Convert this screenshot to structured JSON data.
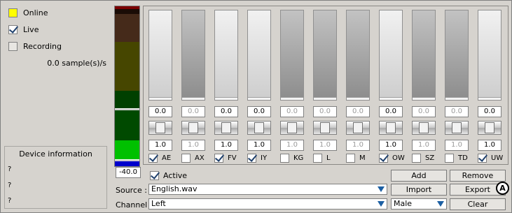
{
  "status": {
    "online_label": "Online",
    "live_label": "Live",
    "live_checked": true,
    "recording_label": "Recording",
    "rate_text": "0.0 sample(s)/s"
  },
  "device_info": {
    "title": "Device information",
    "lines": [
      "?",
      "?",
      "?"
    ]
  },
  "meter": {
    "readout": "-40.0",
    "colors": {
      "top_red": "#7a0000",
      "dark_red": "#452a1a",
      "olive": "#464600",
      "dark_green": "#004000",
      "mid_green": "#004a00",
      "bright_green": "#00c000",
      "blue": "#0000cc"
    }
  },
  "channels": [
    {
      "name": "AE",
      "checked": true,
      "top_value": "0.0",
      "bottom_value": "1.0"
    },
    {
      "name": "AX",
      "checked": false,
      "top_value": "0.0",
      "bottom_value": "1.0"
    },
    {
      "name": "FV",
      "checked": true,
      "top_value": "0.0",
      "bottom_value": "1.0"
    },
    {
      "name": "IY",
      "checked": true,
      "top_value": "0.0",
      "bottom_value": "1.0"
    },
    {
      "name": "KG",
      "checked": false,
      "top_value": "0.0",
      "bottom_value": "1.0"
    },
    {
      "name": "L",
      "checked": false,
      "top_value": "0.0",
      "bottom_value": "1.0"
    },
    {
      "name": "M",
      "checked": false,
      "top_value": "0.0",
      "bottom_value": "1.0"
    },
    {
      "name": "OW",
      "checked": true,
      "top_value": "0.0",
      "bottom_value": "1.0"
    },
    {
      "name": "SZ",
      "checked": false,
      "top_value": "0.0",
      "bottom_value": "1.0"
    },
    {
      "name": "TD",
      "checked": false,
      "top_value": "0.0",
      "bottom_value": "1.0"
    },
    {
      "name": "UW",
      "checked": true,
      "top_value": "0.0",
      "bottom_value": "1.0"
    }
  ],
  "controls": {
    "active_label": "Active",
    "active_checked": true,
    "source_label": "Source :",
    "source_value": "English.wav",
    "channel_label": "Channel :",
    "channel_value": "Left",
    "gender_value": "Male",
    "add_label": "Add",
    "remove_label": "Remove",
    "import_label": "Import",
    "export_label": "Export",
    "clear_label": "Clear",
    "callout_label": "A"
  },
  "colors": {
    "online_indicator": "#ffff00",
    "combo_arrow": "#1c5fa3",
    "checkmark": "#20416d"
  }
}
